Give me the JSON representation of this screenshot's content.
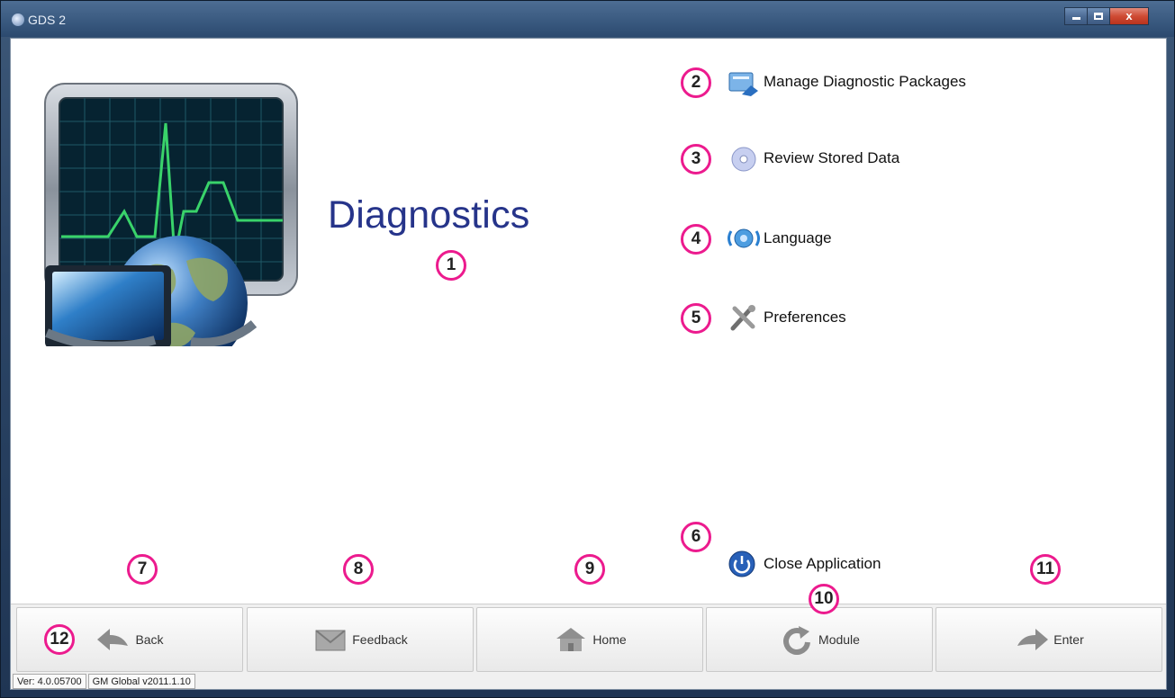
{
  "window": {
    "title": "GDS 2",
    "minimize_label": "minimize",
    "maximize_label": "maximize",
    "close_glyph": "x"
  },
  "main": {
    "title": "Diagnostics",
    "hero_icon": "monitor-globe-heartbeat-illustration"
  },
  "badges": [
    "1",
    "2",
    "3",
    "4",
    "5",
    "6",
    "7",
    "8",
    "9",
    "10",
    "11",
    "12"
  ],
  "menu": {
    "items": [
      {
        "label": "Manage Diagnostic Packages",
        "icon": "package-manager-icon"
      },
      {
        "label": "Review Stored Data",
        "icon": "disc-icon"
      },
      {
        "label": "Language",
        "icon": "language-globe-icon"
      },
      {
        "label": "Preferences",
        "icon": "wrench-screwdriver-icon"
      }
    ],
    "close_label": "Close Application",
    "close_icon": "power-icon"
  },
  "toolbar": {
    "buttons": [
      {
        "label": "Back",
        "icon": "back-arrow-icon"
      },
      {
        "label": "Feedback",
        "icon": "envelope-icon"
      },
      {
        "label": "Home",
        "icon": "house-icon"
      },
      {
        "label": "Module",
        "icon": "refresh-icon"
      },
      {
        "label": "Enter",
        "icon": "forward-arrow-icon"
      }
    ]
  },
  "status": {
    "version": "Ver: 4.0.05700",
    "global": "GM Global v2011.1.10"
  },
  "colors": {
    "badge_ring": "#ec1b8e",
    "title_blue": "#26348a"
  }
}
